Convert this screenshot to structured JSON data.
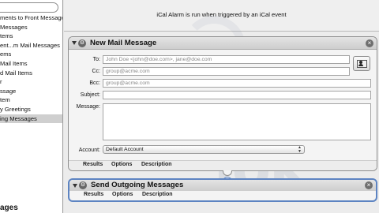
{
  "sidebar": {
    "search_placeholder": "",
    "items": [
      "ments to Front Message",
      "Messages",
      "tems",
      "ent...m Mail Messages",
      "ems",
      " Mail Items",
      "d Mail Items",
      "r",
      "ssage",
      "tem",
      "y Greetings",
      "ing Messages"
    ],
    "selected_index": 11,
    "bottom_title": "ages"
  },
  "workflow": {
    "header_text": "iCal Alarm is run when triggered by an iCal event"
  },
  "watermark": {
    "line1": "mac",
    "line2": "lok"
  },
  "new_mail": {
    "title": "New Mail Message",
    "to_label": "To:",
    "to_value": "John Doe <john@doe.com>, jane@doe.com",
    "cc_label": "Cc:",
    "cc_value": "group@acme.com",
    "bcc_label": "Bcc:",
    "bcc_value": "group@acme.com",
    "subject_label": "Subject:",
    "subject_value": "",
    "message_label": "Message:",
    "account_label": "Account:",
    "account_value": "Default Account",
    "tabs": [
      "Results",
      "Options",
      "Description"
    ]
  },
  "send_outgoing": {
    "title": "Send Outgoing Messages",
    "tabs": [
      "Results",
      "Options",
      "Description"
    ]
  },
  "colors": {
    "selection_border": "#5d84c2",
    "sidebar_selected": "#cfcfcf"
  }
}
